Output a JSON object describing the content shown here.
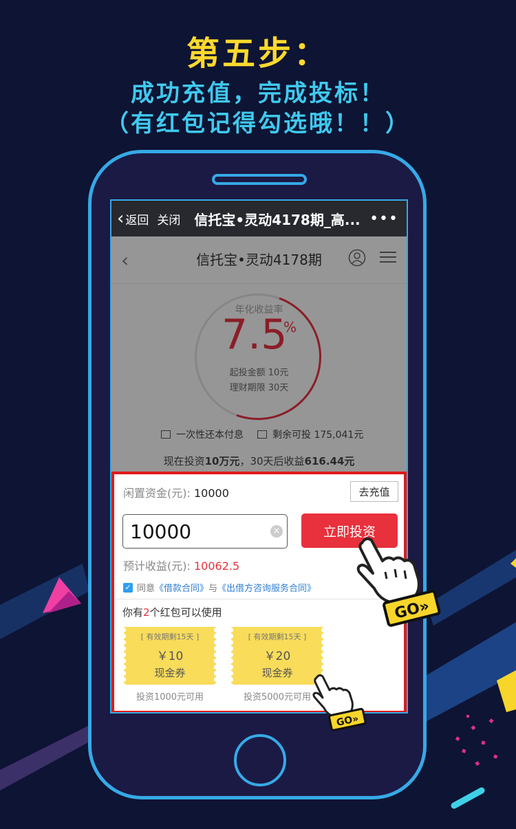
{
  "headline": {
    "step": "第五步：",
    "line1": "成功充值，完成投标！",
    "line2": "（有红包记得勾选哦！！）"
  },
  "wechat_bar": {
    "back_label": "返回",
    "close_label": "关闭",
    "title": "信托宝•灵动4178期_高...",
    "more": "•••"
  },
  "page": {
    "title": "信托宝•灵动4178期",
    "rate_label": "年化收益率",
    "rate_value": "7.5",
    "rate_unit": "%",
    "min_invest": "起投金额 10元",
    "term": "理财期限 30天",
    "repay_method": "一次性还本付息",
    "available": "剩余可投 175,041元",
    "estimate_prefix": "现在投资",
    "estimate_amount": "10万元",
    "estimate_mid": "，30天后收益",
    "estimate_income": "616.44元"
  },
  "panel": {
    "idle_label": "闲置资金(元):",
    "idle_value": "10000",
    "recharge_label": "去充值",
    "amount_value": "10000",
    "invest_label": "立即投资",
    "est_label": "预计收益(元):",
    "est_value": "10062.5",
    "agree_text": "同意",
    "contract1": "《借款合同》",
    "and": "与",
    "contract2": "《出借方咨询服务合同》",
    "redpack_prefix": "你有",
    "redpack_count": "2",
    "redpack_suffix": "个红包可以使用",
    "coupons": [
      {
        "valid": "[ 有效期剩15天 ]",
        "amount": "￥10",
        "type": "现金券",
        "note": "投资1000元可用"
      },
      {
        "valid": "[ 有效期剩15天 ]",
        "amount": "￥20",
        "type": "现金券",
        "note": "投资5000元可用"
      }
    ]
  },
  "go_badge": "GO»",
  "colors": {
    "background": "#0e1433",
    "step_yellow": "#ffd92e",
    "headline_cyan": "#3fc9ee",
    "phone_outline": "#36a9e6",
    "invest_red": "#e8313c",
    "coupon_yellow": "#f8dc5a"
  }
}
